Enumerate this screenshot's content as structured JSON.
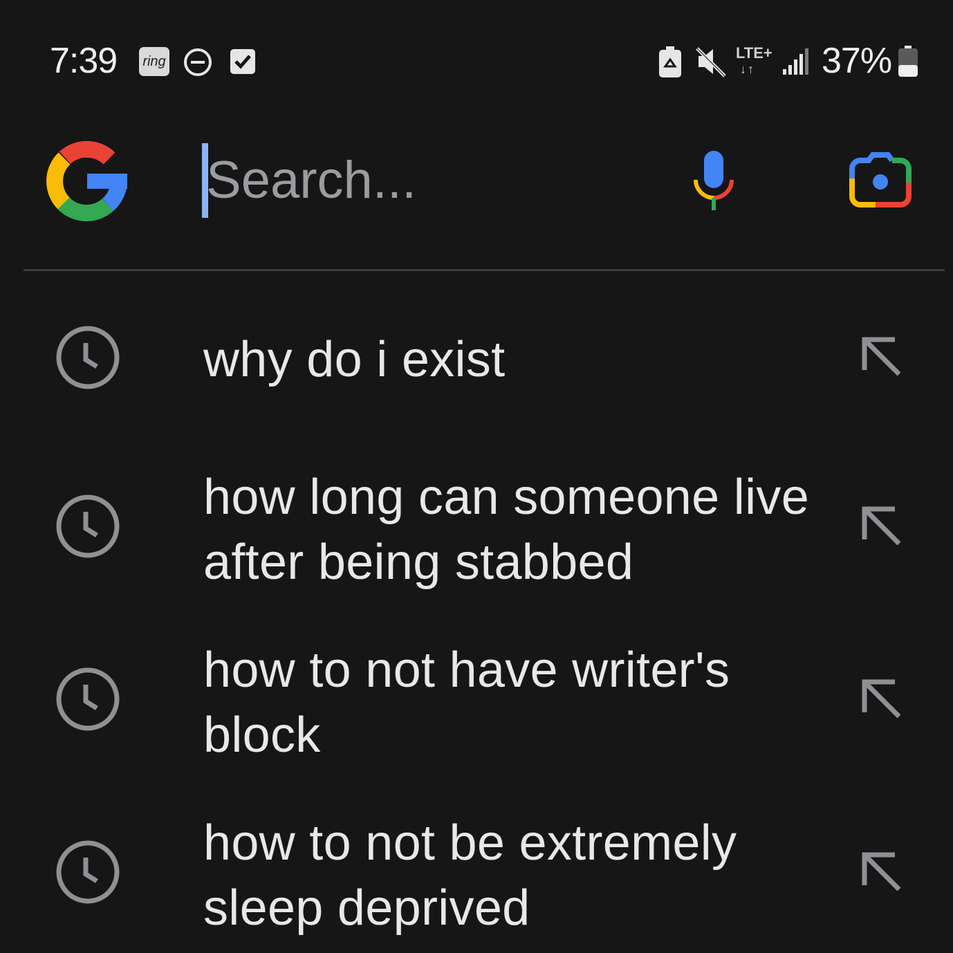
{
  "status_bar": {
    "time": "7:39",
    "ring_badge": "ring",
    "network": "LTE+",
    "network_arrows": "↓↑",
    "battery": "37%",
    "icons": [
      "ring-icon",
      "do-not-disturb-icon",
      "task-check-icon",
      "battery-saver-icon",
      "mute-icon",
      "signal-icon",
      "battery-icon"
    ]
  },
  "search": {
    "placeholder": "Search...",
    "value": "",
    "icons": [
      "google-logo-icon",
      "mic-icon",
      "lens-camera-icon"
    ]
  },
  "suggestions": [
    {
      "text": "why do i exist",
      "icon": "history-clock-icon",
      "action_icon": "fill-arrow-icon"
    },
    {
      "text": "how long can someone live after being stabbed",
      "icon": "history-clock-icon",
      "action_icon": "fill-arrow-icon"
    },
    {
      "text": "how to not have writer's block",
      "icon": "history-clock-icon",
      "action_icon": "fill-arrow-icon"
    },
    {
      "text": "how to not be extremely sleep deprived",
      "icon": "history-clock-icon",
      "action_icon": "fill-arrow-icon"
    }
  ],
  "colors": {
    "background": "#161617",
    "text": "#e8e8e8",
    "icon_gray": "#8e9094",
    "caret": "#8ab4f8",
    "google_blue": "#4285f4",
    "google_red": "#ea4335",
    "google_yellow": "#fbbc05",
    "google_green": "#34a853"
  }
}
